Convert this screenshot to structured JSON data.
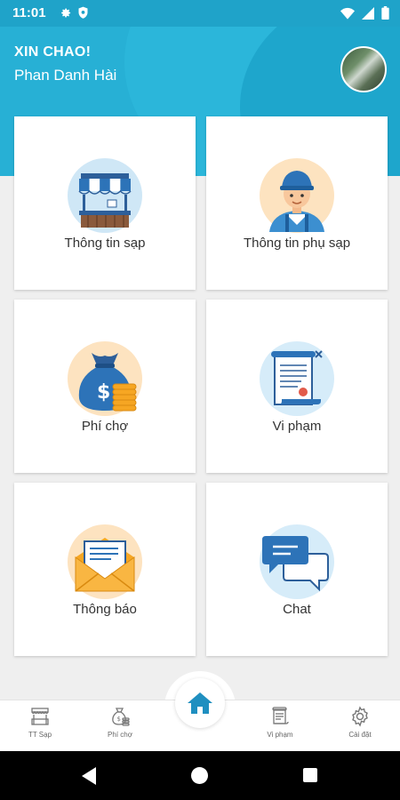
{
  "status_bar": {
    "time": "11:01"
  },
  "header": {
    "greeting": "XIN CHAO!",
    "username": "Phan Danh Hài"
  },
  "menu": [
    {
      "label": "Thông tin sạp",
      "icon": "market-stall-icon"
    },
    {
      "label": "Thông tin phụ sạp",
      "icon": "assistant-person-icon"
    },
    {
      "label": "Phí chợ",
      "icon": "money-bag-icon"
    },
    {
      "label": "Vi phạm",
      "icon": "violation-scroll-icon"
    },
    {
      "label": "Thông báo",
      "icon": "mail-envelope-icon"
    },
    {
      "label": "Chat",
      "icon": "chat-bubbles-icon"
    }
  ],
  "bottom_nav": {
    "items": [
      {
        "label": "TT Sạp",
        "icon": "stall-icon"
      },
      {
        "label": "Phí chợ",
        "icon": "money-bag-icon"
      },
      {
        "label": "",
        "icon": "home-icon"
      },
      {
        "label": "Vi phạm",
        "icon": "document-icon"
      },
      {
        "label": "Cài đặt",
        "icon": "gear-icon"
      }
    ]
  },
  "colors": {
    "header_blue": "#27b0d5",
    "home_icon_blue": "#1f8fc0",
    "background": "#efefef"
  }
}
